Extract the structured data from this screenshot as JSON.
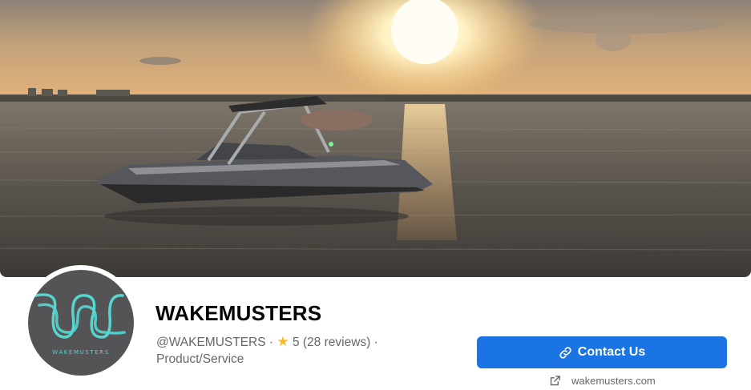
{
  "page": {
    "name": "WAKEMUSTERS",
    "handle": "@WAKEMUSTERS",
    "separator": "·",
    "rating": "5",
    "reviews": "(28 reviews)",
    "category": "Product/Service"
  },
  "avatar": {
    "logo_text": "WAKEMUSTERS",
    "logo_color": "#55d6cf",
    "background_color": "#545456"
  },
  "actions": {
    "contact_label": "Contact Us",
    "contact_icon": "link-icon",
    "website_icon": "external-link-icon",
    "website_text": "wakemusters.com"
  },
  "colors": {
    "accent": "#1b74e4",
    "star": "#f7b928",
    "secondary_text": "#65676b"
  }
}
